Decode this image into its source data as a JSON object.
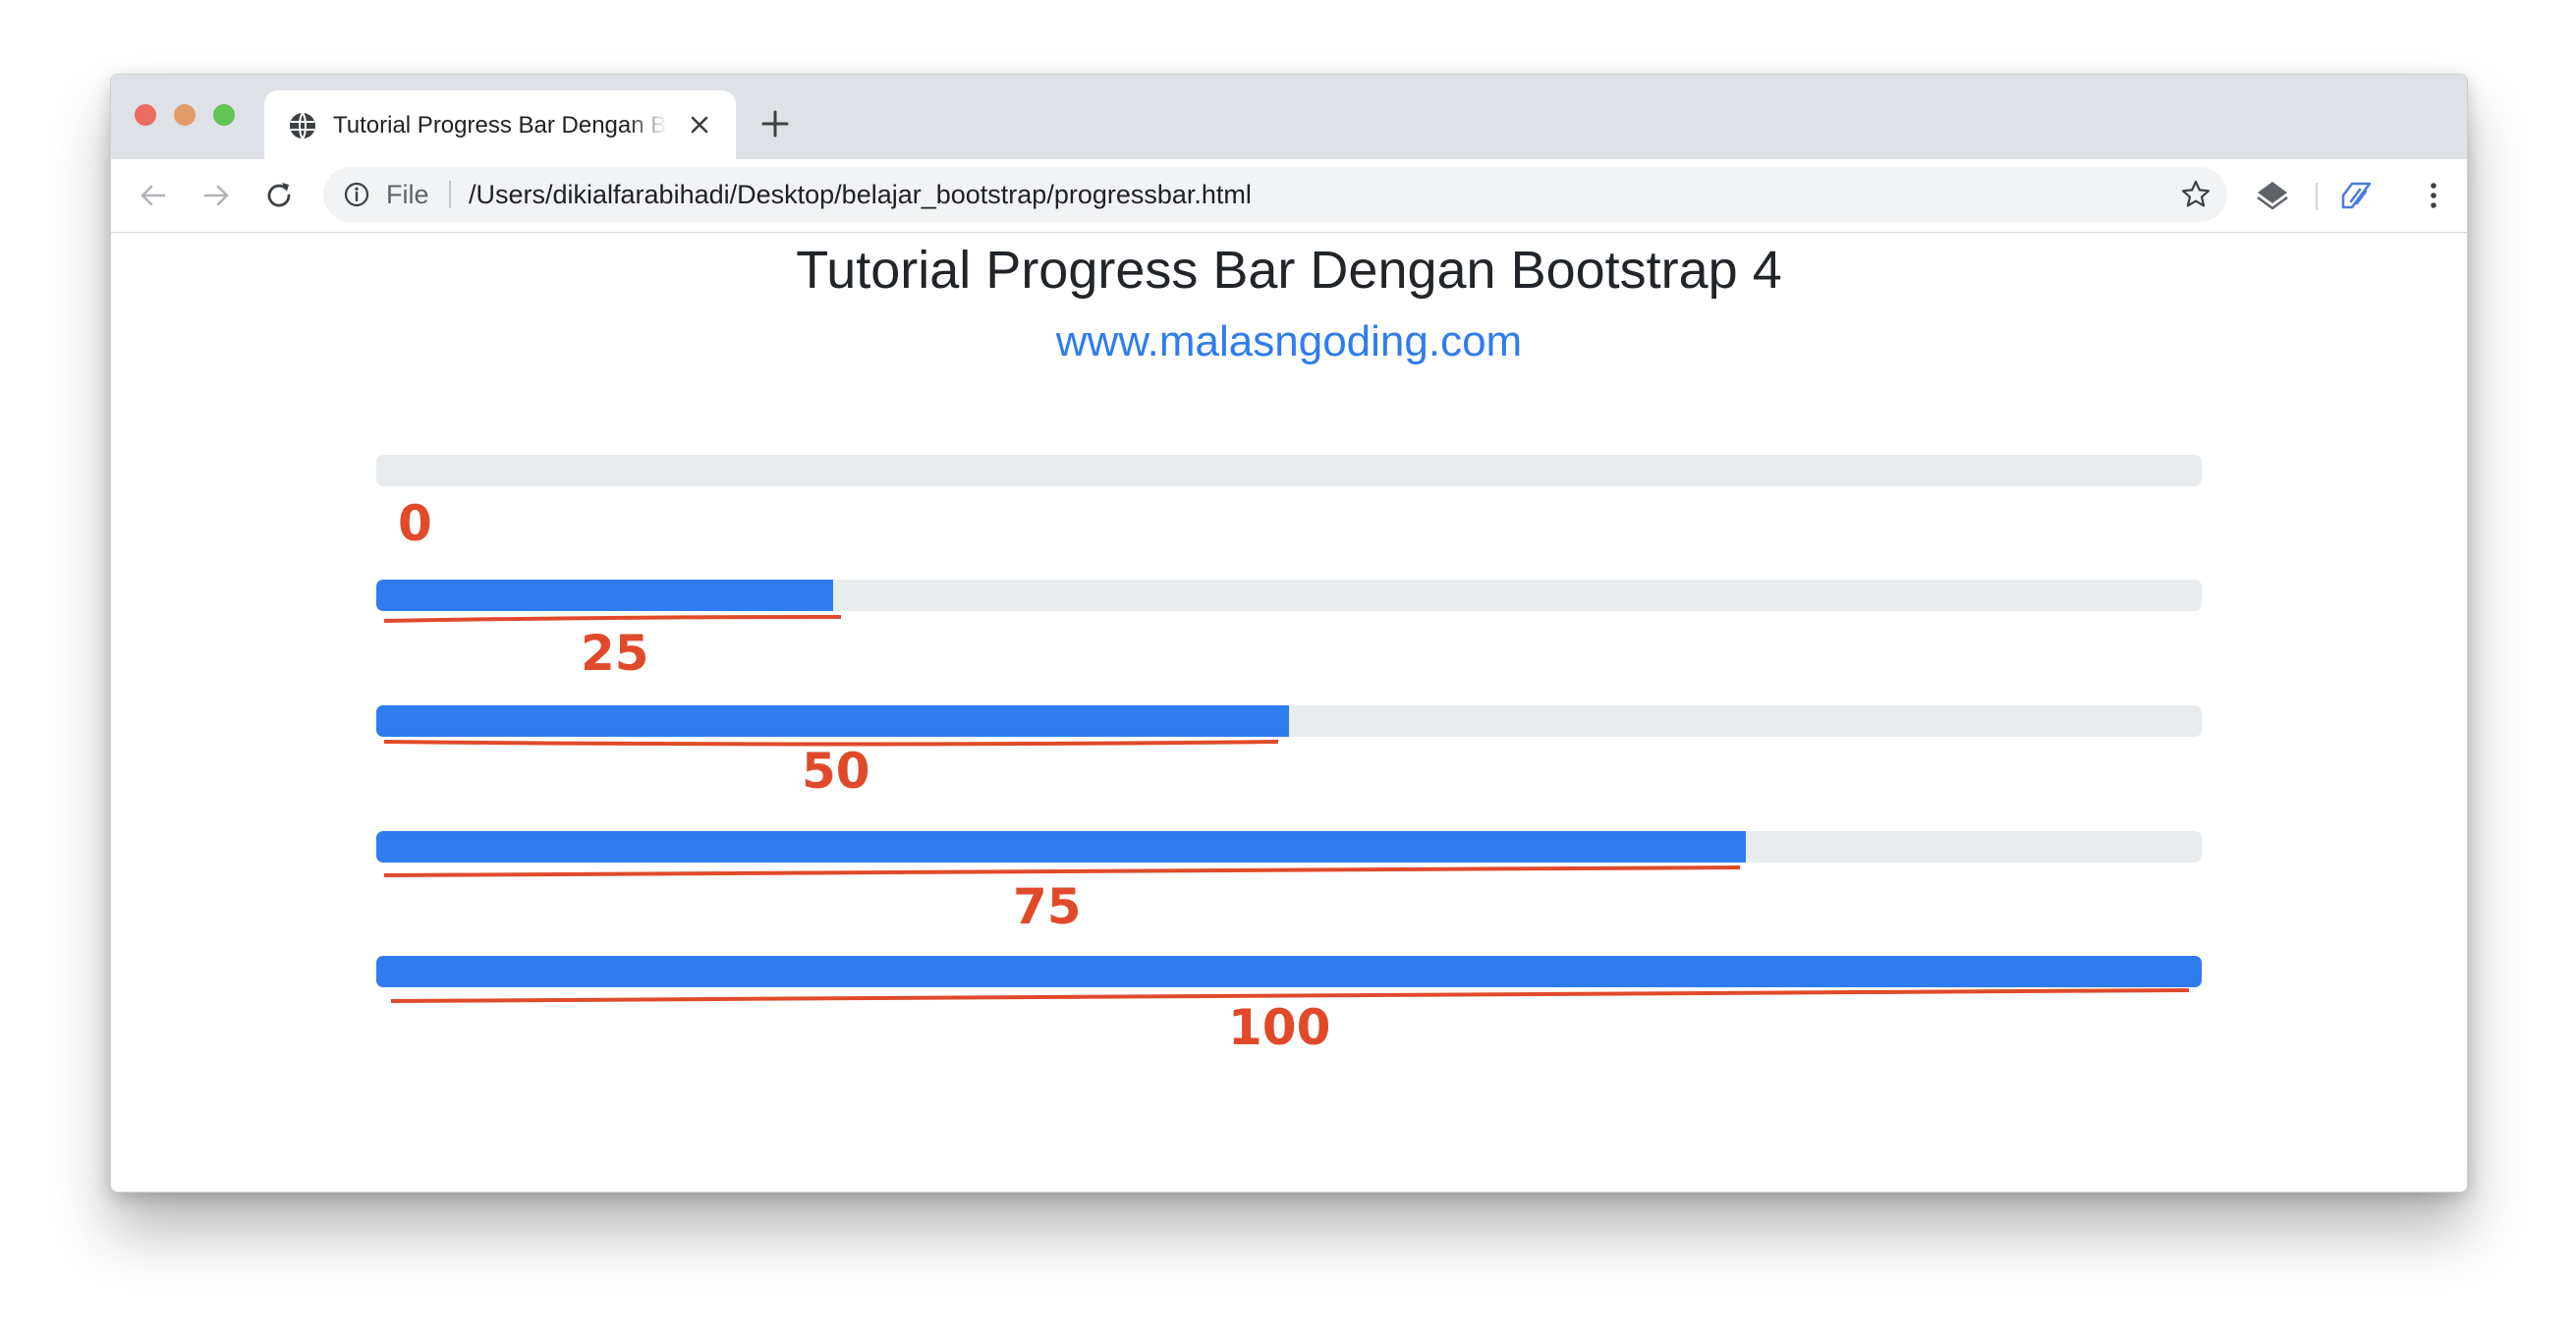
{
  "browser": {
    "tab_title": "Tutorial Progress Bar Dengan Bootstrap 4",
    "address_scheme": "File",
    "address_url": "/Users/dikialfarabihadi/Desktop/belajar_bootstrap/progressbar.html"
  },
  "page": {
    "title": "Tutorial Progress Bar Dengan Bootstrap 4",
    "link": "www.malasngoding.com"
  },
  "progress_bars": [
    {
      "value": 0,
      "label": "0"
    },
    {
      "value": 25,
      "label": "25"
    },
    {
      "value": 50,
      "label": "50"
    },
    {
      "value": 75,
      "label": "75"
    },
    {
      "value": 100,
      "label": "100"
    }
  ],
  "colors": {
    "bar_fill": "#2f7cf0",
    "bar_track": "#e9ecef",
    "annotation": "#e04a2a",
    "link": "#2f7cf0"
  },
  "icons": {
    "tab": "globe-icon",
    "close": "close-icon",
    "new_tab": "plus-icon",
    "back": "back-arrow-icon",
    "forward": "forward-arrow-icon",
    "reload": "reload-icon",
    "site_info": "info-icon",
    "bookmark": "star-icon",
    "extension_1": "layers-icon",
    "extension_2": "extension-brand-icon",
    "menu": "kebab-menu-icon"
  }
}
